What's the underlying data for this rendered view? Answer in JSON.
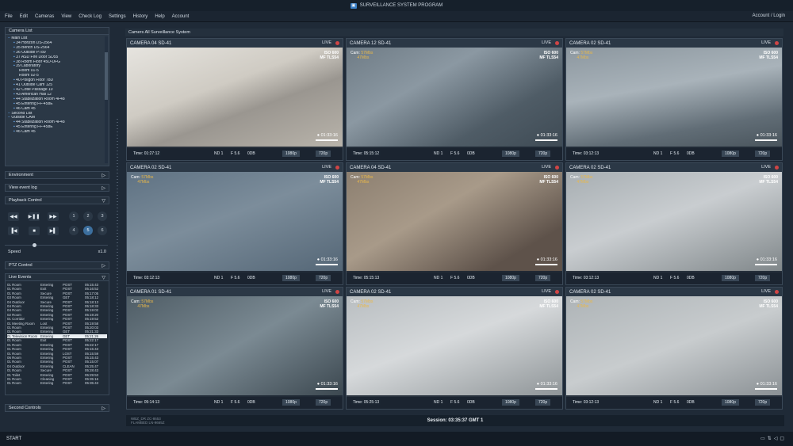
{
  "app_title": "SURVEILLANCE SYSTEM PROGRAM",
  "menu": [
    "File",
    "Edit",
    "Cameras",
    "View",
    "Check Log",
    "Settings",
    "History",
    "Help",
    "Account"
  ],
  "account_link": "Account / Login",
  "camera_list": {
    "header": "Camera List",
    "nodes": [
      {
        "label": "Main List",
        "indent": 1
      },
      {
        "label": "34 Horizon DS-2564",
        "indent": 2
      },
      {
        "label": "35 Bench DS-2564",
        "indent": 2
      },
      {
        "label": "36 Outside PT89",
        "indent": 2
      },
      {
        "label": "37 ASD Fire Door SD55",
        "indent": 2
      },
      {
        "label": "38 Room Floor 45D-DFG",
        "indent": 2
      },
      {
        "label": "39 Laboratory",
        "indent": 2
      },
      {
        "label": "Room 01-5",
        "indent": 3
      },
      {
        "label": "Room 02-5",
        "indent": 3
      },
      {
        "label": "40 Poligon Floor 78D",
        "indent": 2
      },
      {
        "label": "41 Outside Cam 125",
        "indent": 2
      },
      {
        "label": "42 Cotie Passage 10",
        "indent": 2
      },
      {
        "label": "43 American Hall 12",
        "indent": 2
      },
      {
        "label": "44 Stabilization Room 4F48",
        "indent": 2
      },
      {
        "label": "45 Entering FF-458E",
        "indent": 2
      },
      {
        "label": "46 Cam 45",
        "indent": 2
      },
      {
        "label": "Second List",
        "indent": 1
      },
      {
        "label": "Outside CAM",
        "indent": 1
      },
      {
        "label": "44 Stabilization Room 4F48",
        "indent": 2
      },
      {
        "label": "45 Entering FF-458E",
        "indent": 2
      },
      {
        "label": "46 Cam 45",
        "indent": 2
      }
    ]
  },
  "environment": "Environment",
  "view_event_log": "View event log",
  "playback_control": "Playback Control",
  "playback": {
    "rewind": "◀◀",
    "play_pause": "▶❚❚",
    "forward": "▶▶",
    "prev": "▐◀",
    "stop": "■",
    "next": "▶▌",
    "nums": [
      "1",
      "2",
      "3",
      "4",
      "5",
      "6"
    ]
  },
  "speed_label": "Speed",
  "speed_value": "x1.0",
  "speed_fraction": 0.28,
  "ptz_control": "PTZ Control",
  "live_events": {
    "header": "Live Events",
    "rows": [
      [
        "01 Room",
        "Entering",
        "POST",
        "05:15:43"
      ],
      [
        "01 Room",
        "Exit",
        "POST",
        "05:16:52"
      ],
      [
        "01 Room",
        "Secure",
        "POST",
        "05:17:05"
      ],
      [
        "03 Room",
        "Entering",
        "GET",
        "05:18:12"
      ],
      [
        "04 Outdoor",
        "Secure",
        "POST",
        "05:18:13"
      ],
      [
        "04 Room",
        "Entering",
        "POST",
        "05:18:33"
      ],
      [
        "04 Room",
        "Entering",
        "POST",
        "05:19:02"
      ],
      [
        "02 Room",
        "Entering",
        "POST",
        "05:19:20"
      ],
      [
        "01 Corridor",
        "Entering",
        "POST",
        "05:19:52"
      ],
      [
        "01 Meeting Room",
        "Lost",
        "POST",
        "05:19:58"
      ],
      [
        "01 Room",
        "Entering",
        "POST",
        "05:20:03"
      ],
      [
        "01 Room",
        "Entering",
        "GET",
        "05:21:33"
      ],
      [
        "01 Television Room",
        "Entering",
        "GET",
        "05:21:26"
      ],
      [
        "01 Room",
        "Exit",
        "POST",
        "05:22:17"
      ],
      [
        "01 Room",
        "Entering",
        "POST",
        "05:22:17"
      ],
      [
        "01 Room",
        "Entering",
        "POST",
        "05:15:43"
      ],
      [
        "01 Room",
        "Entering",
        "LOST",
        "05:15:59"
      ],
      [
        "06 Room",
        "Entering",
        "POST",
        "05:15:43"
      ],
      [
        "01 Room",
        "Entering",
        "POST",
        "05:15:07"
      ],
      [
        "04 Outdoor",
        "Entering",
        "CLEAN",
        "05:25:47"
      ],
      [
        "01 Room",
        "Secure",
        "POST",
        "05:28:43"
      ],
      [
        "01 Toilet",
        "Entering",
        "POST",
        "05:29:53"
      ],
      [
        "01 Room",
        "Cleaning",
        "POST",
        "05:35:16"
      ],
      [
        "01 Room",
        "Entering",
        "POST",
        "05:35:43"
      ]
    ],
    "highlight_index": 12
  },
  "second_controls": "Second Controls",
  "main_header": "Camers All Surveillance System",
  "cameras": [
    {
      "name": "CAMERA 04 SD-41",
      "live": "LIVE",
      "cam_label": "",
      "cam1": "",
      "cam2": "",
      "iso": "ISO 600",
      "mf": "MF TLS54",
      "rec": "01:33:16",
      "time": "Time: 01:27:12",
      "nd": "ND 1",
      "f": "F 5.6",
      "db": "0DB",
      "res": "1080p",
      "res2": "720p",
      "scene": "lobby"
    },
    {
      "name": "CAMERA 12 SD-41",
      "live": "LIVE",
      "cam_label": "Cam:",
      "cam1": "57Mbs",
      "cam2": "47Mbs",
      "iso": "ISO 600",
      "mf": "MF TLS54",
      "rec": "01:33:16",
      "time": "Time: 05:15:12",
      "nd": "ND 1",
      "f": "F 5.6",
      "db": "0DB",
      "res": "1080p",
      "res2": "720p",
      "scene": "floor"
    },
    {
      "name": "CAMERA 02 SD-41",
      "live": "LIVE",
      "cam_label": "Cam:",
      "cam1": "57Mbs",
      "cam2": "47Mbs",
      "iso": "ISO 600",
      "mf": "MF TLS54",
      "rec": "01:33:16",
      "time": "Time: 03:12:13",
      "nd": "ND 1",
      "f": "F 5.6",
      "db": "0DB",
      "res": "1080p",
      "res2": "720p",
      "scene": "corridor"
    },
    {
      "name": "CAMERA 02 SD-41",
      "live": "LIVE",
      "cam_label": "Cam:",
      "cam1": "57Mbs",
      "cam2": "47Mbs",
      "iso": "ISO 600",
      "mf": "MF TLS54",
      "rec": "01:33:16",
      "time": "Time: 03:12:13",
      "nd": "ND 1",
      "f": "F 5.6",
      "db": "0DB",
      "res": "1080p",
      "res2": "720p",
      "scene": "hall"
    },
    {
      "name": "CAMERA 04 SD-41",
      "live": "LIVE",
      "cam_label": "Cam:",
      "cam1": "57Mbs",
      "cam2": "47Mbs",
      "iso": "ISO 600",
      "mf": "MF TLS54",
      "rec": "01:33:16",
      "time": "Time: 05:15:13",
      "nd": "ND 1",
      "f": "F 5.6",
      "db": "0DB",
      "res": "1080p",
      "res2": "720p",
      "scene": "stairs"
    },
    {
      "name": "CAMERA 02 SD-41",
      "live": "LIVE",
      "cam_label": "Cam:",
      "cam1": "57Mbs",
      "cam2": "47Mbs",
      "iso": "ISO 600",
      "mf": "MF TLS54",
      "rec": "01:33:16",
      "time": "Time: 03:12:13",
      "nd": "ND 1",
      "f": "F 5.6",
      "db": "0DB",
      "res": "1080p",
      "res2": "720p",
      "scene": "office"
    },
    {
      "name": "CAMERA 01 SD-41",
      "live": "LIVE",
      "cam_label": "Cam:",
      "cam1": "57Mbs",
      "cam2": "47Mbs",
      "iso": "ISO 600",
      "mf": "MF TLS54",
      "rec": "01:33:16",
      "time": "Time: 05:14:13",
      "nd": "ND 1",
      "f": "F 5.6",
      "db": "0DB",
      "res": "1080p",
      "res2": "720p",
      "scene": "wall"
    },
    {
      "name": "CAMERA 02 SD-41",
      "live": "LIVE",
      "cam_label": "Cam:",
      "cam1": "57Mbs",
      "cam2": "47Mbs",
      "iso": "ISO 600",
      "mf": "MF TLS54",
      "rec": "01:33:16",
      "time": "Time: 05:25:13",
      "nd": "ND 1",
      "f": "F 5.6",
      "db": "0DB",
      "res": "1080p",
      "res2": "720p",
      "scene": "office2"
    },
    {
      "name": "CAMERA 02 SD-41",
      "live": "LIVE",
      "cam_label": "Cam:",
      "cam1": "57Mbs",
      "cam2": "47Mbs",
      "iso": "ISO 600",
      "mf": "MF TLS54",
      "rec": "01:33:16",
      "time": "Time: 03:12:13",
      "nd": "ND 1",
      "f": "F 5.6",
      "db": "0DB",
      "res": "1080p",
      "res2": "720p",
      "scene": "corridor2"
    }
  ],
  "session_meta_1": "WBZ_DR    ZC-8653",
  "session_meta_2": "FLAMBED   LN-9665Z",
  "session": "Session: 03:35:37 GMT 1",
  "start": "START",
  "tray_icons": [
    "screen-icon",
    "network-icon",
    "volume-icon",
    "chat-icon"
  ]
}
